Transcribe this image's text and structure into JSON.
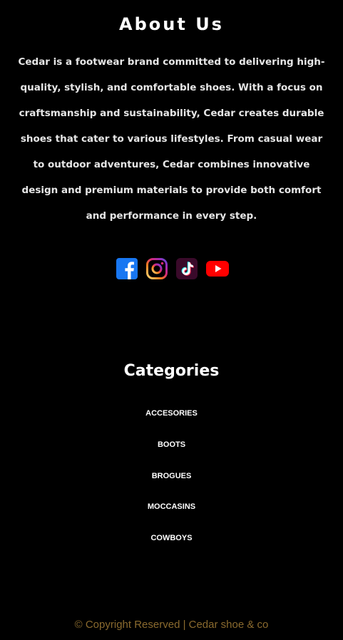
{
  "about": {
    "title": "About Us",
    "text": "Cedar is a footwear brand committed to delivering high-quality, stylish, and comfortable shoes. With a focus on craftsmanship and sustainability, Cedar creates durable shoes that cater to various lifestyles. From casual wear to outdoor adventures, Cedar combines innovative design and premium materials to provide both comfort and performance in every step."
  },
  "social": [
    {
      "icon": "facebook-icon",
      "color": "#1877f2"
    },
    {
      "icon": "instagram-icon",
      "color": "#e1306c"
    },
    {
      "icon": "tiktok-icon",
      "color": "#3a0a2a"
    },
    {
      "icon": "youtube-icon",
      "color": "#ff0000"
    }
  ],
  "categories": {
    "title": "Categories",
    "items": [
      "ACCESORIES",
      "BOOTS",
      "BROGUES",
      "MOCCASINS",
      "COWBOYS"
    ]
  },
  "footer": {
    "copyright": "© Copyright Reserved | Cedar shoe & co",
    "copyright_color": "#8a6a2e"
  },
  "colors": {
    "background": "#000000",
    "text": "#ffffff"
  }
}
